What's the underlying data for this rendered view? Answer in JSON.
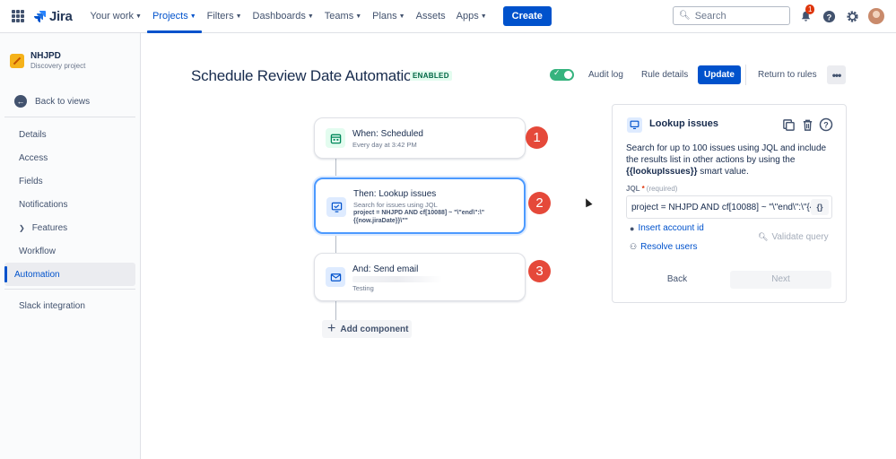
{
  "topnav": {
    "logo_text": "Jira",
    "items": [
      {
        "label": "Your work",
        "active": false
      },
      {
        "label": "Projects",
        "active": true
      },
      {
        "label": "Filters",
        "active": false
      },
      {
        "label": "Dashboards",
        "active": false
      },
      {
        "label": "Teams",
        "active": false
      },
      {
        "label": "Plans",
        "active": false
      },
      {
        "label": "Assets",
        "active": false
      },
      {
        "label": "Apps",
        "active": false
      }
    ],
    "create_label": "Create",
    "search_placeholder": "Search",
    "notification_count": "1"
  },
  "sidebar": {
    "project_name": "NHJPD",
    "project_type": "Discovery project",
    "back_label": "Back to views",
    "items": [
      {
        "label": "Details"
      },
      {
        "label": "Access"
      },
      {
        "label": "Fields"
      },
      {
        "label": "Notifications"
      },
      {
        "label": "Features"
      },
      {
        "label": "Workflow"
      },
      {
        "label": "Automation"
      }
    ],
    "bottom_item": "Slack integration"
  },
  "header": {
    "title": "Schedule Review Date Automation",
    "status": "ENABLED",
    "audit_log": "Audit log",
    "rule_details": "Rule details",
    "update": "Update",
    "return_to_rules": "Return to rules"
  },
  "flow": {
    "step1": {
      "title": "When: Scheduled",
      "subtitle": "Every day at 3:42 PM",
      "number": "1"
    },
    "step2": {
      "title": "Then: Lookup issues",
      "subtitle": "Search for issues using JQL",
      "jql": "project = NHJPD AND cf[10088] ~ \"\\\"end\\\":\\\"{{now.jiraDate}}\\\"\"",
      "number": "2"
    },
    "step3": {
      "title": "And: Send email",
      "subtitle": "Testing",
      "number": "3"
    },
    "add_component": "Add component"
  },
  "panel": {
    "title": "Lookup issues",
    "desc_part1": "Search for up to 100 issues using JQL and include the results list in other actions by using the ",
    "desc_smart": "{{lookupIssues}}",
    "desc_part2": " smart value.",
    "jql_label": "JQL",
    "jql_required_mark": "*",
    "jql_required_text": "(required)",
    "jql_value": "project = NHJPD AND cf[10088] ~ \"\\\"end\\\":\\\"{{now.jiraDate}}\\\"\"",
    "braces": "{}",
    "insert_account": "Insert account id",
    "resolve_users": "Resolve users",
    "validate": "Validate query",
    "back": "Back",
    "next": "Next"
  }
}
